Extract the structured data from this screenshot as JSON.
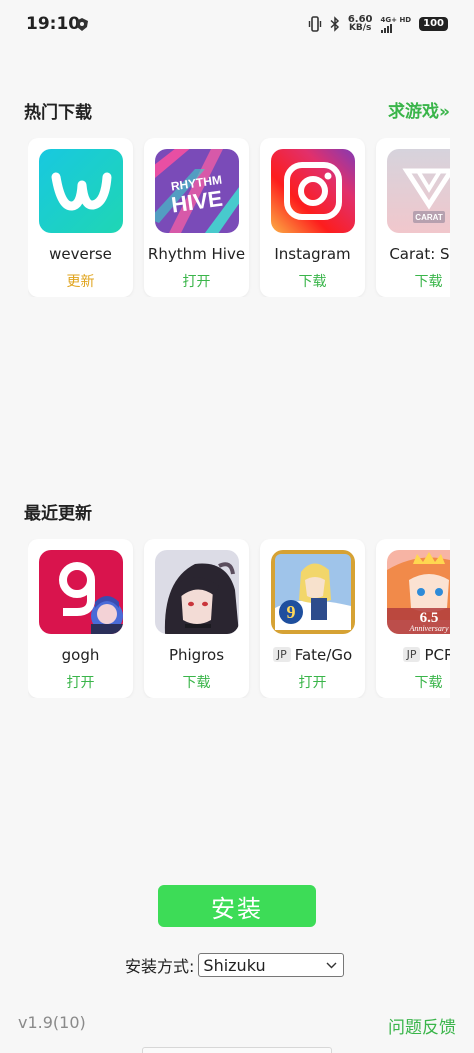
{
  "status": {
    "time": "19:10",
    "speed": "6.60",
    "speed_unit": "KB/s",
    "network": "4G+ HD",
    "battery": "100"
  },
  "hot": {
    "title": "热门下载",
    "more": "求游戏»",
    "apps": [
      {
        "name": "weverse",
        "action": "更新",
        "icon": "weverse-icon"
      },
      {
        "name": "Rhythm Hive",
        "action": "打开",
        "icon": "rhythm-hive-icon"
      },
      {
        "name": "Instagram",
        "action": "下载",
        "icon": "instagram-icon"
      },
      {
        "name": "Carat: Sev",
        "action": "下载",
        "icon": "carat-icon"
      }
    ]
  },
  "recent": {
    "title": "最近更新",
    "apps": [
      {
        "name": "gogh",
        "tag": "",
        "action": "打开",
        "icon": "gogh-icon"
      },
      {
        "name": "Phigros",
        "tag": "",
        "action": "下载",
        "icon": "phigros-icon"
      },
      {
        "name": "Fate/Go",
        "tag": "JP",
        "action": "打开",
        "icon": "fate-go-icon"
      },
      {
        "name": "PCR",
        "tag": "JP",
        "action": "下载",
        "icon": "pcr-icon"
      }
    ]
  },
  "icon_text": {
    "rhythm": "RHYTHM",
    "hive": "HIVE",
    "carat": "CARAT",
    "fgo_anniv": "9",
    "pcr_anniv": "6.5",
    "pcr_sub": "Anniversary"
  },
  "install": {
    "button": "安装",
    "method_label": "安装方式:",
    "method_value": "Shizuku"
  },
  "footer": {
    "version": "v1.9(10)",
    "feedback": "问题反馈"
  },
  "colors": {
    "accent": "#3ab54a",
    "install_button": "#3ddc57",
    "update": "#e0a41e"
  }
}
